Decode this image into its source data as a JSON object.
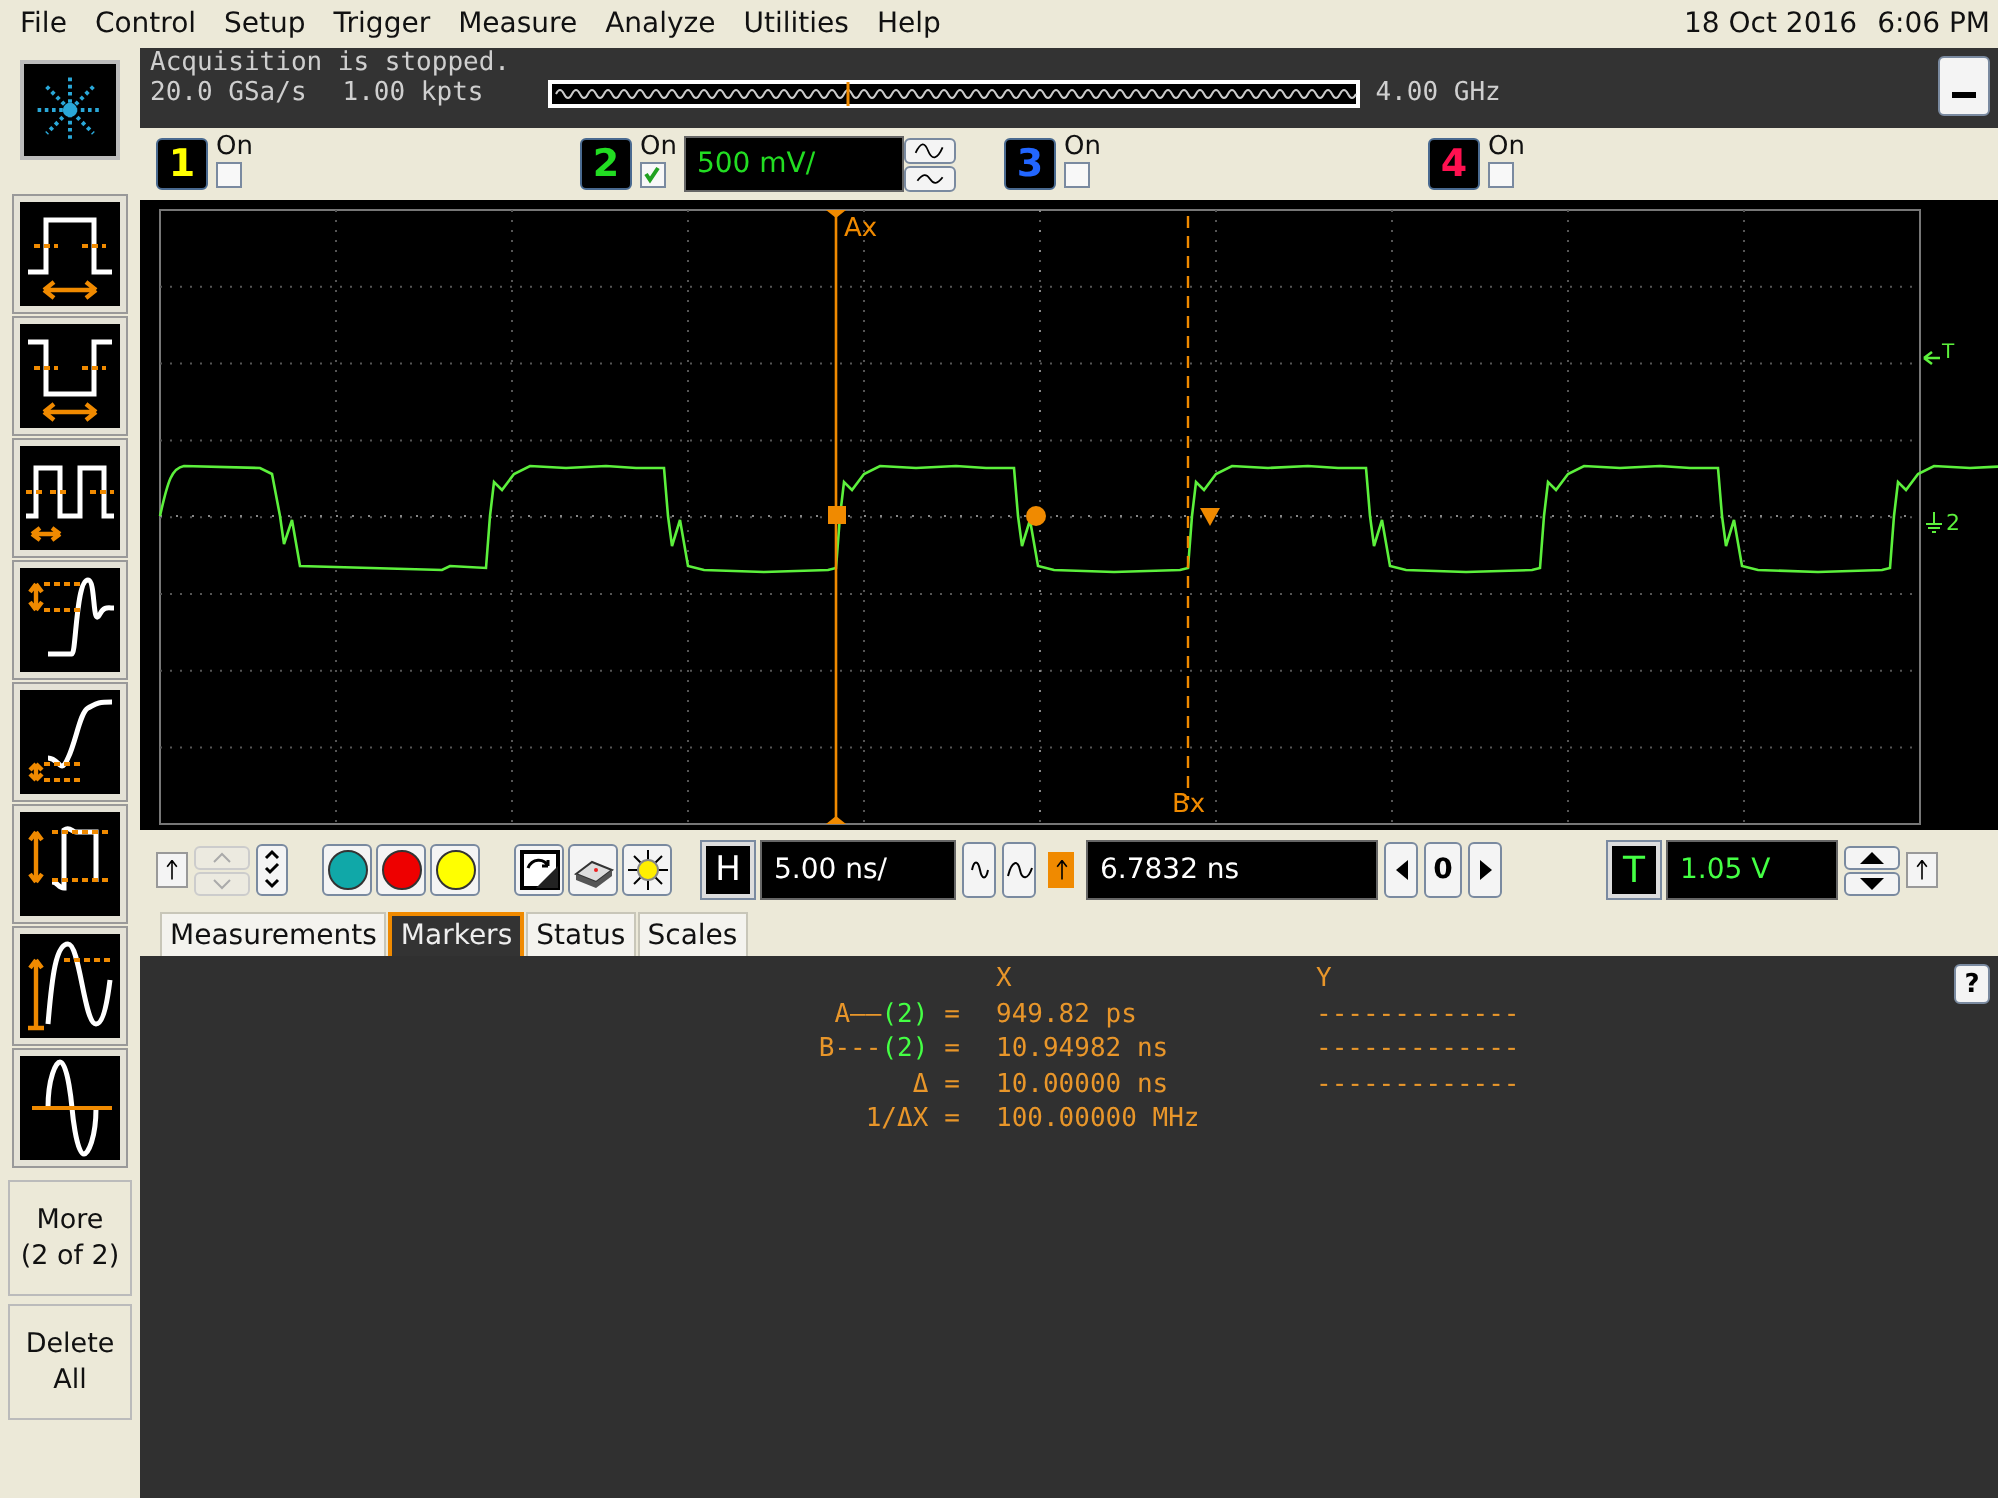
{
  "menu": [
    "File",
    "Control",
    "Setup",
    "Trigger",
    "Measure",
    "Analyze",
    "Utilities",
    "Help"
  ],
  "clock": {
    "date": "18 Oct 2016",
    "time": "6:06 PM"
  },
  "acquisition": {
    "status": "Acquisition is stopped.",
    "rate": "20.0 GSa/s",
    "memory": "1.00 kpts",
    "bandwidth": "4.00 GHz"
  },
  "channels": [
    {
      "number": "1",
      "label": "On",
      "checked": false,
      "color": "#ffff00"
    },
    {
      "number": "2",
      "label": "On",
      "checked": true,
      "color": "#22dd22",
      "scale": "500 mV/"
    },
    {
      "number": "3",
      "label": "On",
      "checked": false,
      "color": "#2266ff"
    },
    {
      "number": "4",
      "label": "On",
      "checked": false,
      "color": "#ff1050"
    }
  ],
  "scope": {
    "ax_label": "Ax",
    "bx_label": "Bx",
    "trigger_marker": "T",
    "level_marker": "2"
  },
  "controls": {
    "horizontal": "H",
    "timebase": "5.00 ns/",
    "delay": "6.7832 ns",
    "step": "0",
    "trigger": "T",
    "trigger_level": "1.05 V"
  },
  "tabs": [
    {
      "label": "Measurements",
      "selected": false
    },
    {
      "label": "Markers",
      "selected": true
    },
    {
      "label": "Status",
      "selected": false
    },
    {
      "label": "Scales",
      "selected": false
    }
  ],
  "markers": {
    "columns": [
      "X",
      "Y"
    ],
    "rows": [
      {
        "name": "A——",
        "source": "(2)",
        "sign": "=",
        "x": "949.82 ps",
        "y": "-------------"
      },
      {
        "name": "B---",
        "source": "(2)",
        "sign": "=",
        "x": "10.94982 ns",
        "y": "-------------"
      },
      {
        "name": "Δ",
        "sign": "=",
        "x": "10.00000 ns",
        "y": "-------------"
      },
      {
        "name": "1/ΔX",
        "sign": "=",
        "x": "100.00000 MHz"
      }
    ]
  },
  "help": "?",
  "side_buttons": [
    "More\n(2 of 2)",
    "Delete\nAll"
  ]
}
